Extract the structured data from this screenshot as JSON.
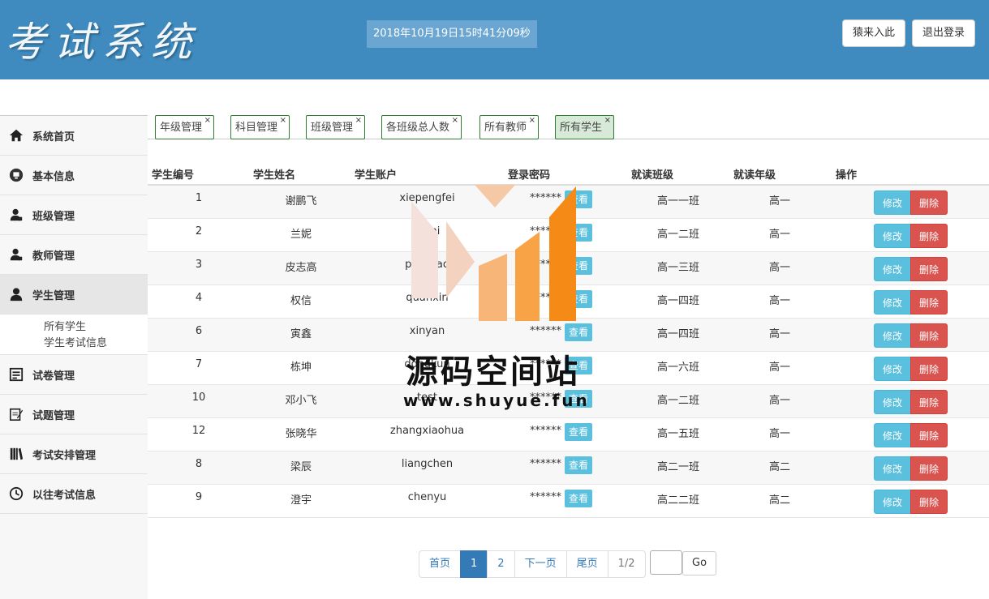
{
  "header": {
    "logo": "考试系统",
    "datetime": "2018年10月19日15时41分09秒",
    "btn_welcome": "猿来入此",
    "btn_logout": "退出登录"
  },
  "sidebar": {
    "items": [
      {
        "label": "系统首页",
        "icon": "home-icon"
      },
      {
        "label": "基本信息",
        "icon": "monitor-icon"
      },
      {
        "label": "班级管理",
        "icon": "users-icon"
      },
      {
        "label": "教师管理",
        "icon": "users-icon"
      },
      {
        "label": "学生管理",
        "icon": "user-icon"
      },
      {
        "label": "试卷管理",
        "icon": "paper-icon"
      },
      {
        "label": "试题管理",
        "icon": "edit-icon"
      },
      {
        "label": "考试安排管理",
        "icon": "books-icon"
      },
      {
        "label": "以往考试信息",
        "icon": "clock-icon"
      }
    ],
    "sub_items": [
      "所有学生",
      "学生考试信息"
    ]
  },
  "tabs": [
    "年级管理",
    "科目管理",
    "班级管理",
    "各班级总人数",
    "所有教师",
    "所有学生"
  ],
  "table": {
    "headers": [
      "学生编号",
      "学生姓名",
      "学生账户",
      "登录密码",
      "就读班级",
      "就读年级",
      "操作"
    ],
    "view_label": "查看",
    "edit_label": "修改",
    "delete_label": "删除",
    "rows": [
      {
        "id": "1",
        "name": "谢鹏飞",
        "account": "xiepengfei",
        "password": "******",
        "class": "高一一班",
        "grade": "高一"
      },
      {
        "id": "2",
        "name": "兰妮",
        "account": "lanni",
        "password": "******",
        "class": "高一二班",
        "grade": "高一"
      },
      {
        "id": "3",
        "name": "皮志高",
        "account": "pizhigao",
        "password": "******",
        "class": "高一三班",
        "grade": "高一"
      },
      {
        "id": "4",
        "name": "权信",
        "account": "quanxin",
        "password": "******",
        "class": "高一四班",
        "grade": "高一"
      },
      {
        "id": "6",
        "name": "寅鑫",
        "account": "xinyan",
        "password": "******",
        "class": "高一四班",
        "grade": "高一"
      },
      {
        "id": "7",
        "name": "栋坤",
        "account": "dongkun",
        "password": "******",
        "class": "高一六班",
        "grade": "高一"
      },
      {
        "id": "10",
        "name": "邓小飞",
        "account": "test",
        "password": "******",
        "class": "高一二班",
        "grade": "高一"
      },
      {
        "id": "12",
        "name": "张晓华",
        "account": "zhangxiaohua",
        "password": "******",
        "class": "高一五班",
        "grade": "高一"
      },
      {
        "id": "8",
        "name": "梁辰",
        "account": "liangchen",
        "password": "******",
        "class": "高二一班",
        "grade": "高二"
      },
      {
        "id": "9",
        "name": "澄宇",
        "account": "chenyu",
        "password": "******",
        "class": "高二二班",
        "grade": "高二"
      }
    ]
  },
  "pagination": {
    "first": "首页",
    "pages": [
      "1",
      "2"
    ],
    "current": "1",
    "next": "下一页",
    "last": "尾页",
    "info": "1/2",
    "go": "Go"
  },
  "watermark": {
    "text": "源码空间站",
    "url": "www.shuyue.fun"
  },
  "colors": {
    "header_bg": "#3f8bbf",
    "info": "#5bc0de",
    "danger": "#d9534f",
    "primary": "#337ab7"
  }
}
